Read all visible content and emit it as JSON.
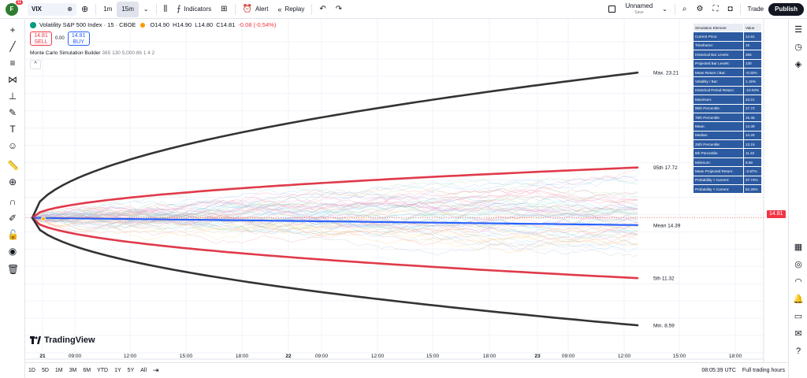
{
  "topbar": {
    "avatar_letter": "F",
    "avatar_badge": "11",
    "symbol": "VIX",
    "timeframes": [
      "1m",
      "15m"
    ],
    "active_timeframe": "15m",
    "indicators_label": "Indicators",
    "alert_label": "Alert",
    "replay_label": "Replay",
    "layout_name": "Unnamed",
    "layout_status": "Save",
    "trade_label": "Trade",
    "publish_label": "Publish"
  },
  "legend": {
    "title": "Volatility S&P 500 Index · 15 · CBOE",
    "open": "O14.90",
    "high": "H14.90",
    "low": "L14.80",
    "close": "C14.81",
    "change": "-0.08 (-0.54%)"
  },
  "order": {
    "sell_price": "14.81",
    "sell_label": "SELL",
    "spread": "0.00",
    "buy_price": "14.81",
    "buy_label": "BUY"
  },
  "indicator": {
    "name": "Monte Carlo Simulation Builder",
    "params": "365 130 5,000 86 1 4 2",
    "collapse_icon": "^"
  },
  "sim_table": {
    "headers": [
      "Simulation Element",
      "Value"
    ],
    "rows": [
      [
        "Current Price:",
        "14.81"
      ],
      [
        "Timeframe:",
        "15"
      ],
      [
        "Historical Bar Levels:",
        "365"
      ],
      [
        "Projected Bar Levels:",
        "130"
      ],
      [
        "Mean Return / Bar:",
        "-0.03%"
      ],
      [
        "Volatility / Bar:",
        "1.15%"
      ],
      [
        "Historical Period Return:",
        "-10.02%"
      ],
      [
        "Maximum:",
        "23.21"
      ],
      [
        "95th Percentile:",
        "17.72"
      ],
      [
        "75th Percentile:",
        "15.45"
      ],
      [
        "Mean:",
        "14.39"
      ],
      [
        "Median:",
        "14.25"
      ],
      [
        "25th Percentile:",
        "13.15"
      ],
      [
        "5th Percentile:",
        "11.32"
      ],
      [
        "Minimum:",
        "8.59"
      ],
      [
        "Mean Projected Return:",
        "-2.87%"
      ],
      [
        "Probability > Current:",
        "37.74%"
      ],
      [
        "Probability < Current:",
        "62.26%"
      ]
    ]
  },
  "curve_labels": {
    "max": "Max.  23.21",
    "p95": "95th  17.72",
    "mean": "Mean  14.39",
    "p5": "5th  11.32",
    "min": "Min.  8.59"
  },
  "price_axis": {
    "unit_label": "point",
    "current_price": "14.81"
  },
  "bottombar": {
    "ranges": [
      "1D",
      "5D",
      "1M",
      "3M",
      "6M",
      "YTD",
      "1Y",
      "5Y",
      "All"
    ],
    "clock": "08:05:39 UTC",
    "session": "Full trading hours"
  },
  "branding": {
    "logo_text": "TradingView"
  },
  "colors": {
    "max_min_curve": "#333333",
    "percentile_curve": "#e03a4a",
    "mean_line": "#2962ff",
    "price_tag": "#f23645",
    "table_bg": "#2c5aa0"
  },
  "chart_data": {
    "type": "line",
    "ylim": [
      7,
      26
    ],
    "yticks": [
      7,
      8,
      9,
      10,
      11,
      12,
      13,
      14,
      15,
      16,
      17,
      18,
      19,
      20,
      21,
      22,
      23,
      24,
      25
    ],
    "xticks": [
      "21",
      "09:00",
      "12:00",
      "15:00",
      "18:00",
      "22",
      "09:00",
      "12:00",
      "15:00",
      "18:00",
      "23",
      "09:00",
      "12:00",
      "15:00",
      "18:00"
    ],
    "start_value": 14.81,
    "series": [
      {
        "name": "Max.",
        "start": 14.81,
        "end": 23.21
      },
      {
        "name": "95th",
        "start": 14.81,
        "end": 17.72
      },
      {
        "name": "Mean",
        "start": 14.81,
        "end": 14.39
      },
      {
        "name": "5th",
        "start": 14.81,
        "end": 11.32
      },
      {
        "name": "Min.",
        "start": 14.81,
        "end": 8.59
      }
    ],
    "grid": true
  }
}
